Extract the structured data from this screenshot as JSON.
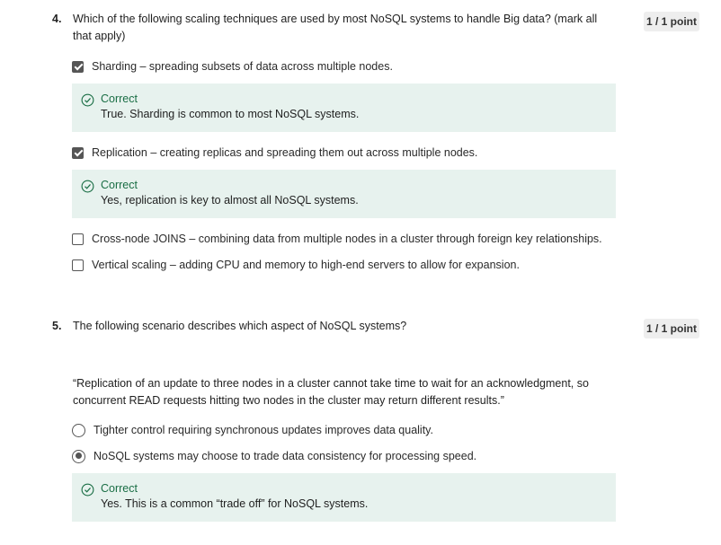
{
  "q4": {
    "number": "4.",
    "text": "Which of the following scaling techniques are used by most NoSQL systems to handle Big data? (mark all that apply)",
    "score": "1 / 1 point",
    "options": [
      {
        "label": "Sharding – spreading subsets of data across multiple nodes.",
        "checked": true
      },
      {
        "label": "Replication – creating replicas and spreading them out across multiple nodes.",
        "checked": true
      },
      {
        "label": "Cross-node JOINS – combining data from multiple nodes in a cluster through foreign key relationships.",
        "checked": false
      },
      {
        "label": "Vertical scaling – adding CPU and memory to high-end servers to allow for expansion.",
        "checked": false
      }
    ],
    "feedback": [
      {
        "title": "Correct",
        "text": "True. Sharding is common to most NoSQL systems.",
        "icon": "check-circle-icon"
      },
      {
        "title": "Correct",
        "text": "Yes, replication is key to almost all NoSQL systems.",
        "icon": "check-circle-icon"
      }
    ]
  },
  "q5": {
    "number": "5.",
    "text": "The following scenario describes which aspect of NoSQL systems?",
    "score": "1 / 1 point",
    "quote": "“Replication of an update to three nodes in a cluster cannot take time to wait for an acknowledgment, so concurrent READ requests hitting two nodes in the cluster may return different results.”",
    "options": [
      {
        "label": "Tighter control requiring synchronous updates improves data quality.",
        "selected": false
      },
      {
        "label": "NoSQL systems may choose to trade data consistency for processing speed.",
        "selected": true
      }
    ],
    "feedback": {
      "title": "Correct",
      "text": "Yes. This is a common “trade off” for NoSQL systems.",
      "icon": "check-circle-icon"
    }
  },
  "colors": {
    "correct_green": "#1a6e45",
    "feedback_bg": "#e7f2ee",
    "badge_bg": "#eeeeee"
  }
}
